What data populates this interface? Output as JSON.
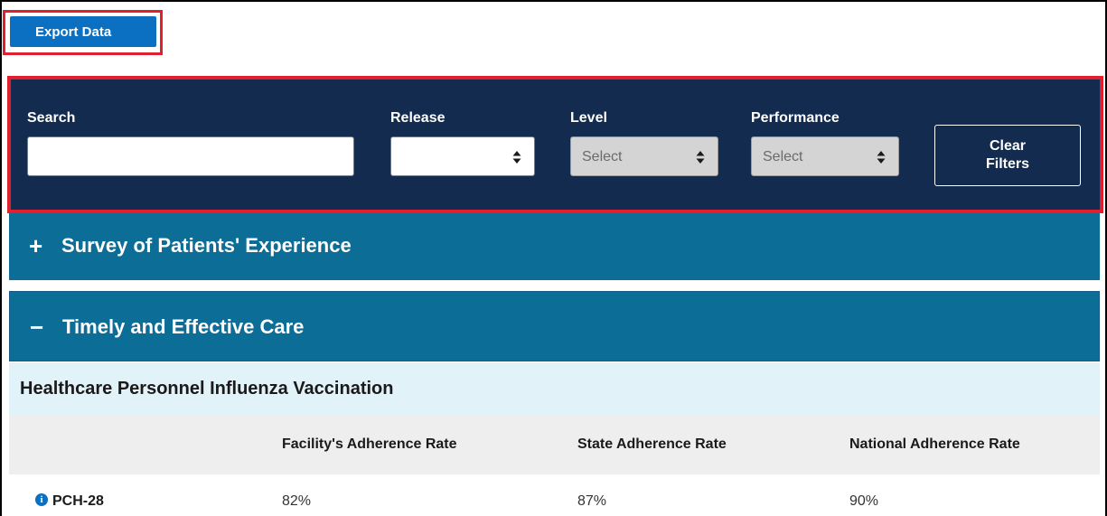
{
  "export": {
    "label": "Export Data"
  },
  "filters": {
    "search_label": "Search",
    "search_value": "",
    "release_label": "Release",
    "release_value": "",
    "level_label": "Level",
    "level_value": "Select",
    "performance_label": "Performance",
    "performance_value": "Select",
    "clear_line1": "Clear",
    "clear_line2": "Filters"
  },
  "accordions": [
    {
      "symbol": "+",
      "title": "Survey of Patients' Experience",
      "expanded": false
    },
    {
      "symbol": "−",
      "title": "Timely and Effective Care",
      "expanded": true
    }
  ],
  "measure_group": {
    "title": "Healthcare Personnel Influenza Vaccination",
    "columns": [
      "",
      "Facility's Adherence Rate",
      "State Adherence Rate",
      "National Adherence Rate"
    ],
    "rows": [
      {
        "id": "PCH-28",
        "facility": "82%",
        "state": "87%",
        "national": "90%"
      }
    ]
  },
  "colors": {
    "highlight_border": "#e0202e",
    "filter_bg": "#122b4f",
    "accordion_bg": "#0c6d97",
    "button_blue": "#0b70c2"
  },
  "icons": {
    "info": "info-circle-icon",
    "select_arrow": "sort-arrows-icon"
  }
}
